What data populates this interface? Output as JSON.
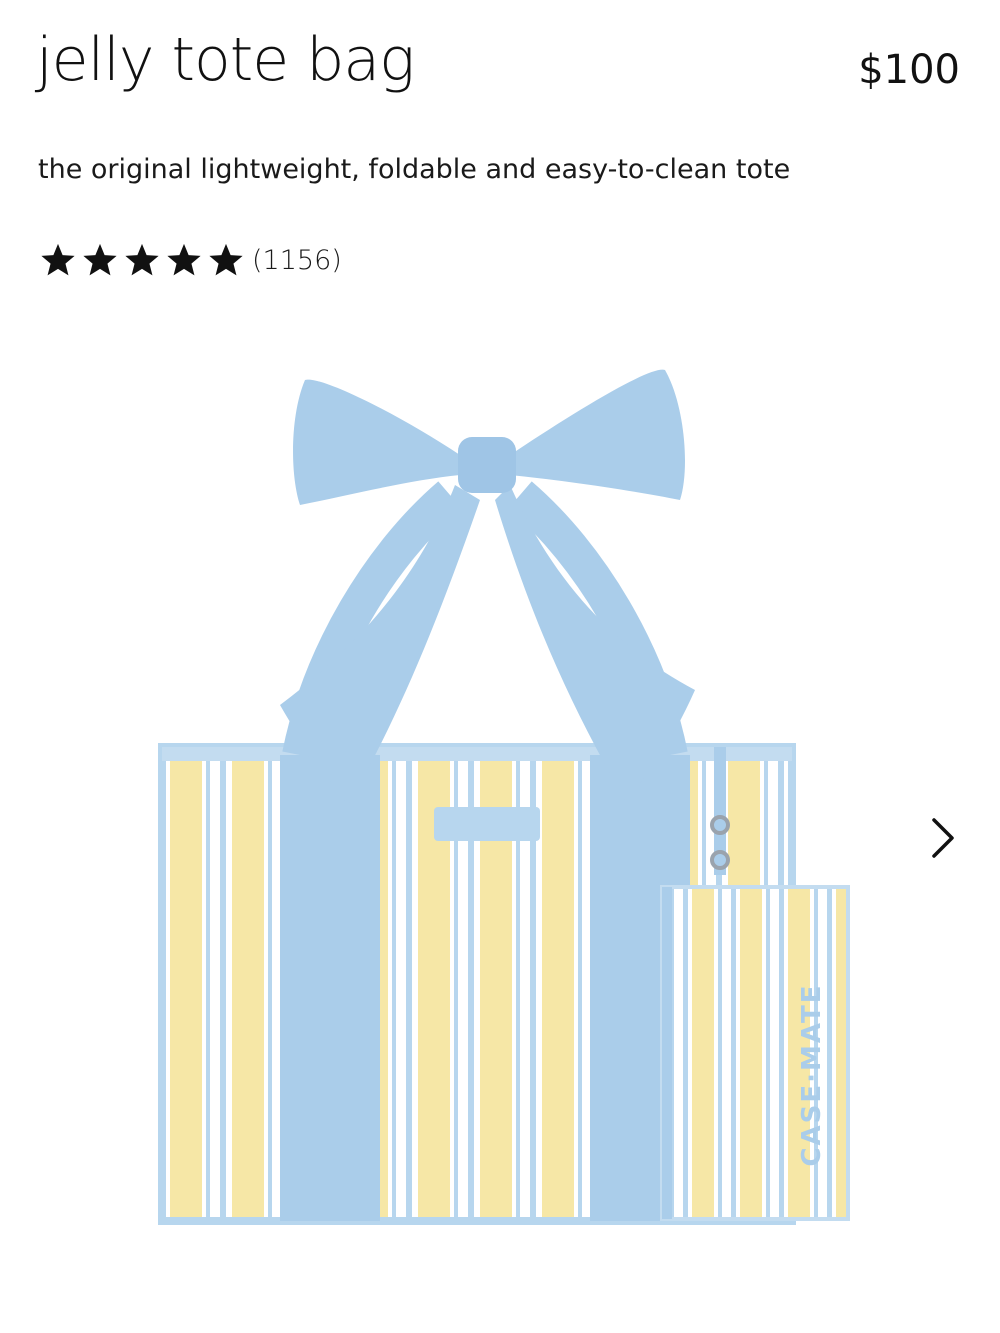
{
  "product": {
    "title": "jelly tote bag",
    "price": "$100",
    "subtitle": "the original lightweight, foldable and easy-to-clean tote"
  },
  "rating": {
    "stars": 5,
    "count_label": "(1156)"
  },
  "image": {
    "brand_mark": "CASE·MATE",
    "colors": {
      "blue": "#aacdea",
      "yellow": "#f5e6a3",
      "white": "#ffffff"
    }
  },
  "carousel": {
    "next_icon": "chevron-right-icon"
  }
}
